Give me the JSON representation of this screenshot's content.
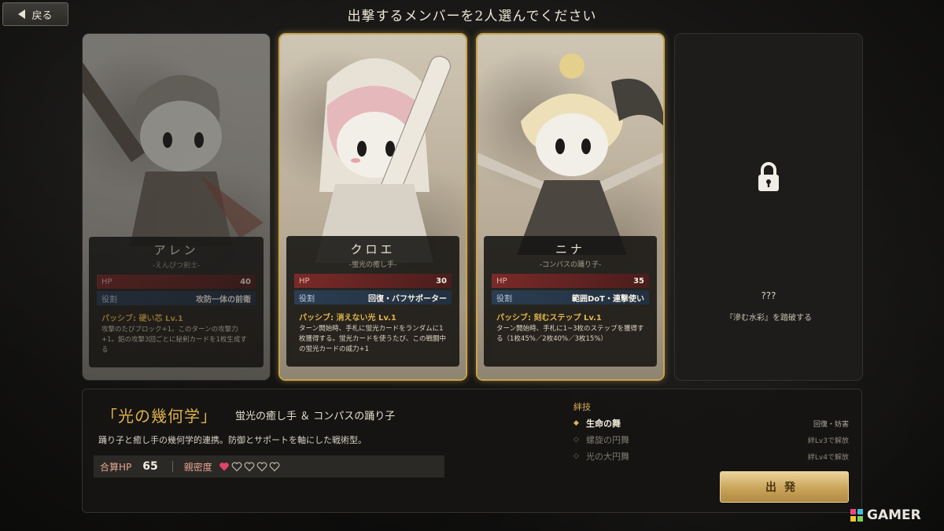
{
  "header": {
    "back_label": "戻る",
    "title": "出撃するメンバーを2人選んでください"
  },
  "cards": [
    {
      "name": "アレン",
      "title": "-えんぴつ剣士-",
      "hp_label": "HP",
      "hp": "40",
      "role_label": "役割",
      "role": "攻防一体の前衛",
      "passive_name": "パッシブ: 硬い芯 Lv.1",
      "passive_desc": "攻撃のたびブロック+1。このターンの攻撃力+1。鉛の攻撃3回ごとに秘剣カードを1枚生成する",
      "selected": false
    },
    {
      "name": "クロエ",
      "title": "-蛍光の癒し手-",
      "hp_label": "HP",
      "hp": "30",
      "role_label": "役割",
      "role": "回復・バフサポーター",
      "passive_name": "パッシブ: 消えない光 Lv.1",
      "passive_desc": "ターン開始時、手札に蛍光カードをランダムに1枚獲得する。蛍光カードを使うたび、この戦闘中の蛍光カードの威力+1",
      "selected": true
    },
    {
      "name": "ニナ",
      "title": "-コンパスの踊り子-",
      "hp_label": "HP",
      "hp": "35",
      "role_label": "役割",
      "role": "範囲DoT・連撃使い",
      "passive_name": "パッシブ: 刻むステップ Lv.1",
      "passive_desc": "ターン開始時、手札に1~3枚のステップを獲得する（1枚45%／2枚40%／3枚15%）",
      "selected": true
    },
    {
      "name": "???",
      "hint": "『滲む水彩』を踏破する",
      "locked": true
    }
  ],
  "combo": {
    "name": "「光の幾何学」",
    "members": "蛍光の癒し手 ＆ コンパスの踊り子",
    "desc": "踊り子と癒し手の幾何学的連携。防御とサポートを軸にした戦術型。",
    "total_hp_label": "合算HP",
    "total_hp": "65",
    "affinity_label": "親密度",
    "affinity_level": 1,
    "affinity_max": 5,
    "heart_color_filled": "#e0446a",
    "heart_color_empty": "#bdb6a8"
  },
  "bond_skills": {
    "label": "絆技",
    "items": [
      {
        "mark": "◆",
        "name": "生命の舞",
        "note": "回復・妨害",
        "active": true
      },
      {
        "mark": "◇",
        "name": "螺旋の円舞",
        "note": "絆Lv3で解放",
        "active": false
      },
      {
        "mark": "◇",
        "name": "光の大円舞",
        "note": "絆Lv4で解放",
        "active": false
      }
    ]
  },
  "depart_label": "出発",
  "watermark": "GAMER",
  "colors": {
    "gold": "#c9a54f",
    "accent_text": "#dfb24a"
  }
}
